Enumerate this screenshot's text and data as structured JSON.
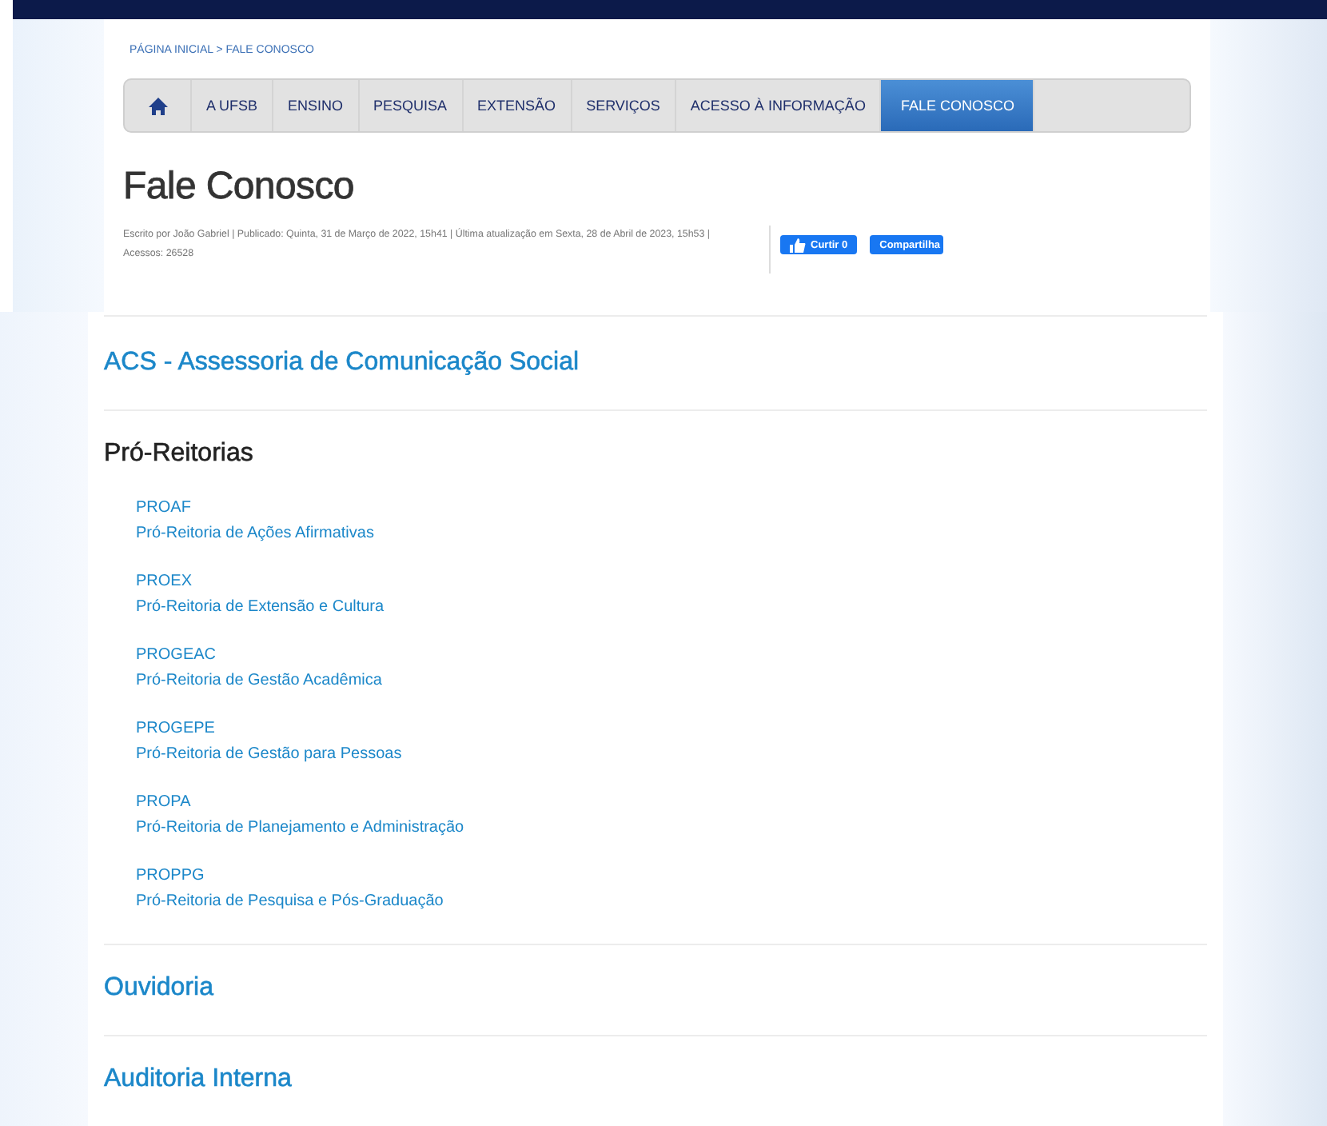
{
  "breadcrumb": "PÁGINA INICIAL > FALE CONOSCO",
  "nav": [
    {
      "label": "A UFSB",
      "selected": false
    },
    {
      "label": "ENSINO",
      "selected": false
    },
    {
      "label": "PESQUISA",
      "selected": false
    },
    {
      "label": "EXTENSÃO",
      "selected": false
    },
    {
      "label": "SERVIÇOS",
      "selected": false
    },
    {
      "label": "ACESSO À INFORMAÇÃO",
      "selected": false
    },
    {
      "label": "FALE CONOSCO",
      "selected": true
    }
  ],
  "title": "Fale Conosco",
  "meta": "Escrito por João Gabriel | Publicado: Quinta, 31 de Março de 2022, 15h41 | Última atualização em Sexta, 28 de Abril de 2023, 15h53 | Acessos: 26528",
  "social": {
    "like": "Curtir 0",
    "share": "Compartilha"
  },
  "sections": [
    {
      "kind": "link",
      "title": "ACS - Assessoria de Comunicação Social"
    },
    {
      "kind": "list",
      "title": "Pró-Reitorias",
      "items": [
        {
          "code": "PROAF",
          "name": "Pró-Reitoria de Ações Afirmativas"
        },
        {
          "code": "PROEX",
          "name": "Pró-Reitoria de Extensão e Cultura"
        },
        {
          "code": "PROGEAC",
          "name": "Pró-Reitoria de Gestão Acadêmica"
        },
        {
          "code": "PROGEPE",
          "name": "Pró-Reitoria de Gestão para Pessoas"
        },
        {
          "code": "PROPA",
          "name": "Pró-Reitoria de Planejamento e Administração"
        },
        {
          "code": "PROPPG",
          "name": "Pró-Reitoria de Pesquisa e Pós-Graduação"
        }
      ]
    },
    {
      "kind": "link",
      "title": "Ouvidoria"
    },
    {
      "kind": "link",
      "title": "Auditoria Interna"
    }
  ]
}
